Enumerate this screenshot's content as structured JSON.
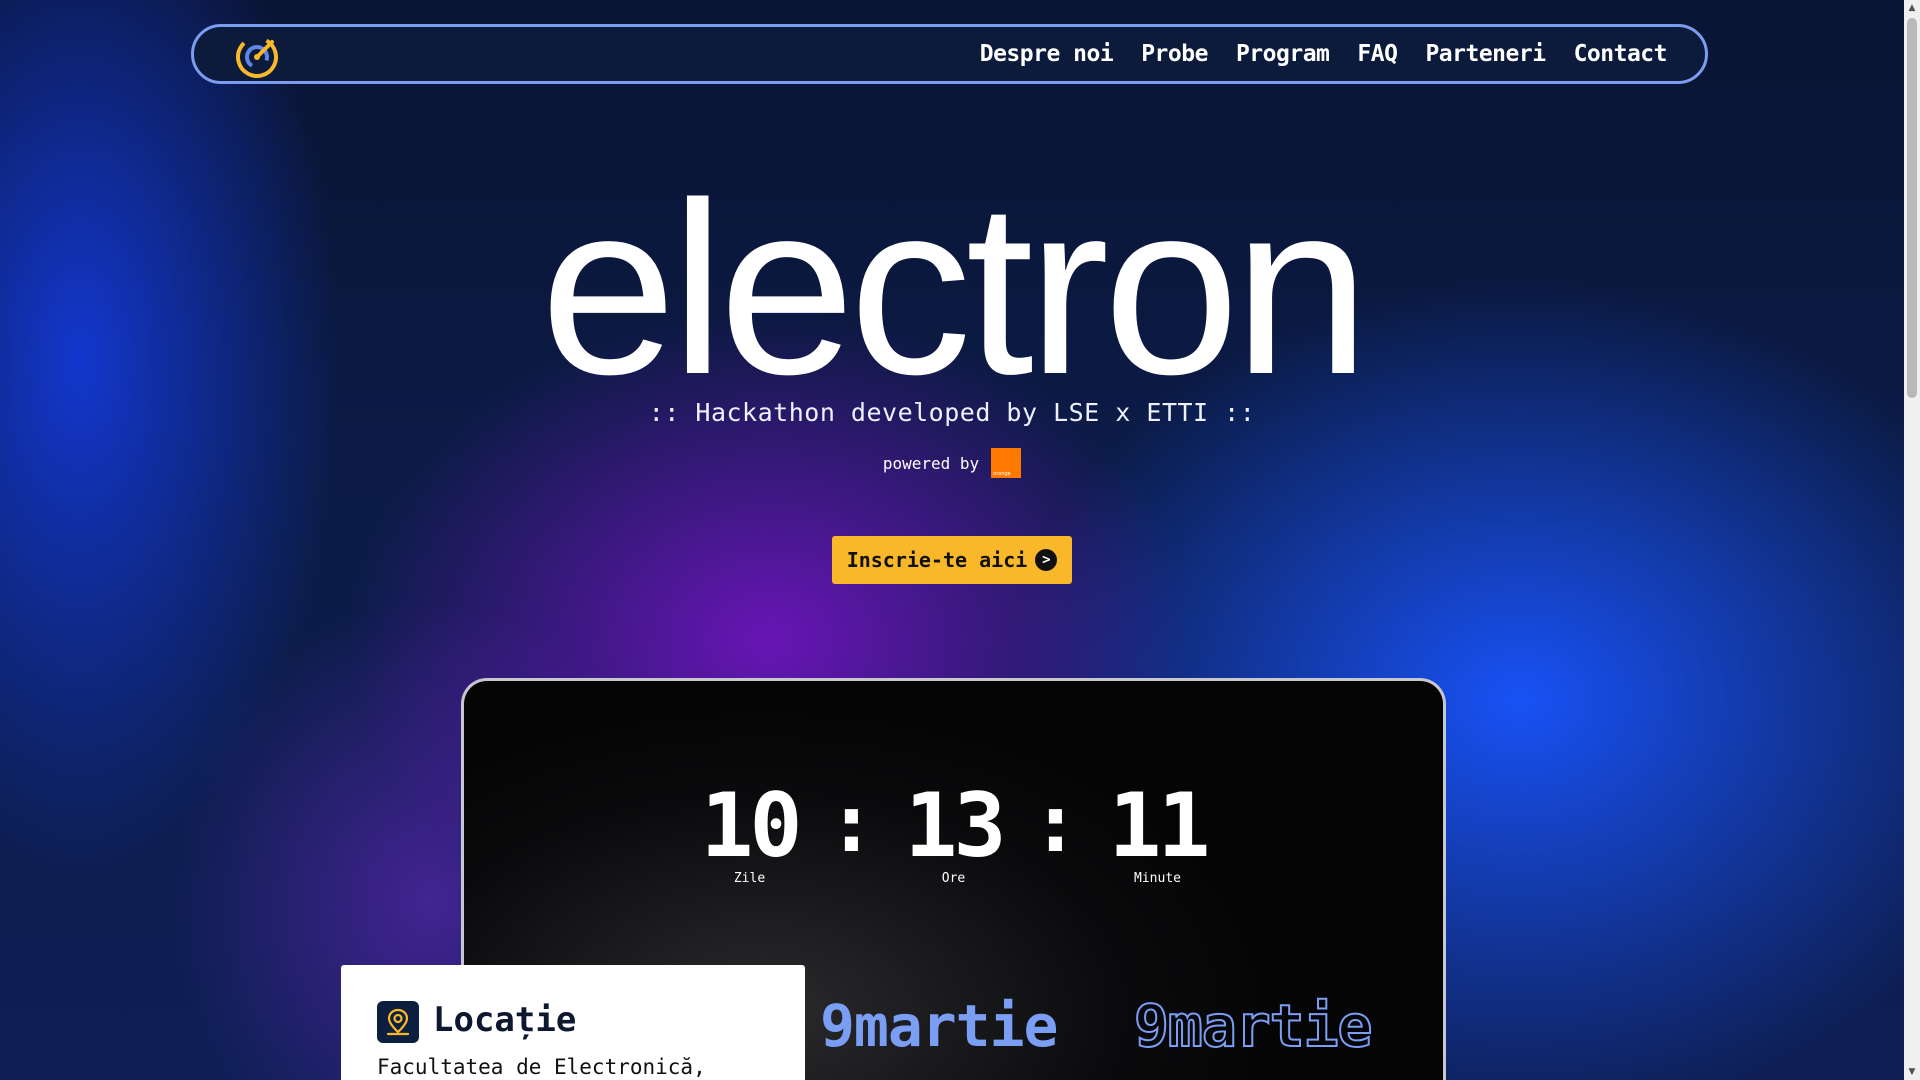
{
  "nav": {
    "logo_icon": "electron-logo-icon",
    "links": [
      "Despre noi",
      "Probe",
      "Program",
      "FAQ",
      "Parteneri",
      "Contact"
    ]
  },
  "hero": {
    "title": "electron",
    "subtitle": ":: Hackathon developed by LSE x ETTI ::",
    "powered_by": "powered by",
    "sponsor_logo_text": "orange",
    "cta_label": "Inscrie-te aici",
    "cta_arrow": ">"
  },
  "countdown": {
    "days": "10",
    "days_label": "Zile",
    "hours": "13",
    "hours_label": "Ore",
    "minutes": "11",
    "minutes_label": "Minute",
    "separator": ":"
  },
  "date": {
    "solid": "9martie",
    "outline": "9martie"
  },
  "location": {
    "title": "Locație",
    "text": "Facultatea de Electronică,"
  },
  "colors": {
    "accent_yellow": "#f9b82a",
    "accent_blue": "#7b9ef5",
    "nav_border": "#7c9cf0",
    "orange_brand": "#ff7900"
  }
}
